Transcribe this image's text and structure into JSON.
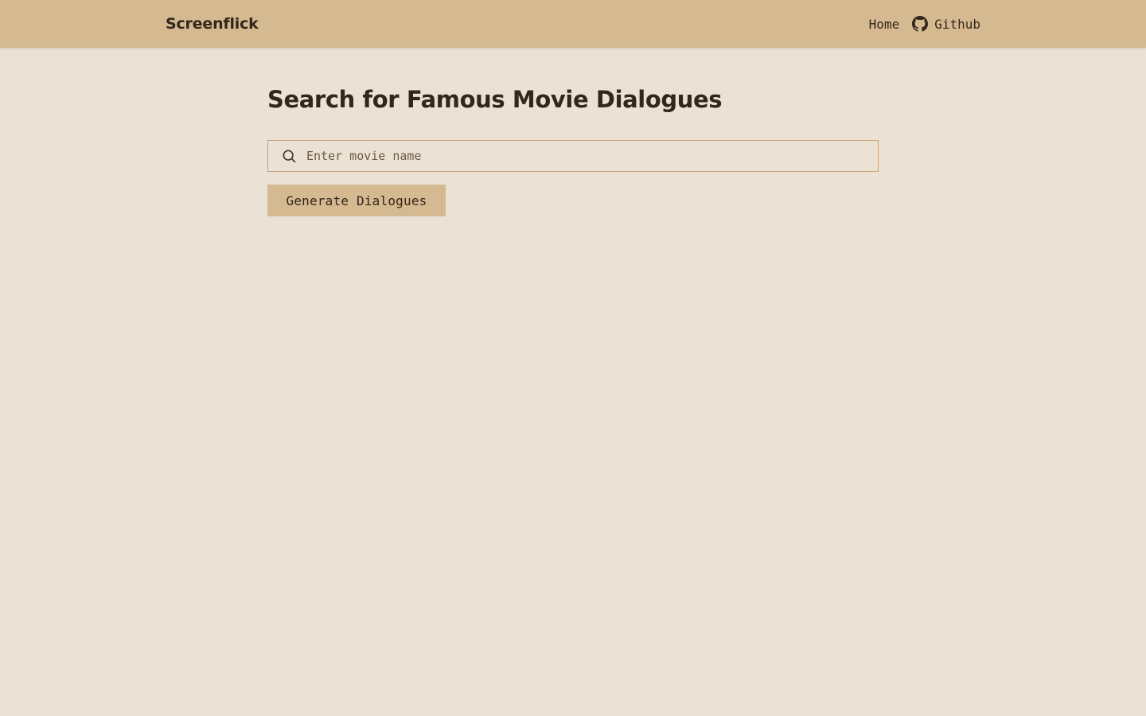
{
  "navbar": {
    "brand": "Screenflick",
    "links": [
      {
        "label": "Home",
        "icon": null
      },
      {
        "label": "Github",
        "icon": "github-icon"
      }
    ],
    "background_color": "#d5b991"
  },
  "main": {
    "title": "Search for Famous Movie Dialogues",
    "search": {
      "icon": "search-icon",
      "placeholder": "Enter movie name",
      "value": ""
    },
    "generate_label": "Generate Dialogues"
  },
  "colors": {
    "page_background": "#ebe2d5",
    "accent": "#d5b991",
    "text": "#33261a",
    "input_border": "#c4a36f"
  }
}
